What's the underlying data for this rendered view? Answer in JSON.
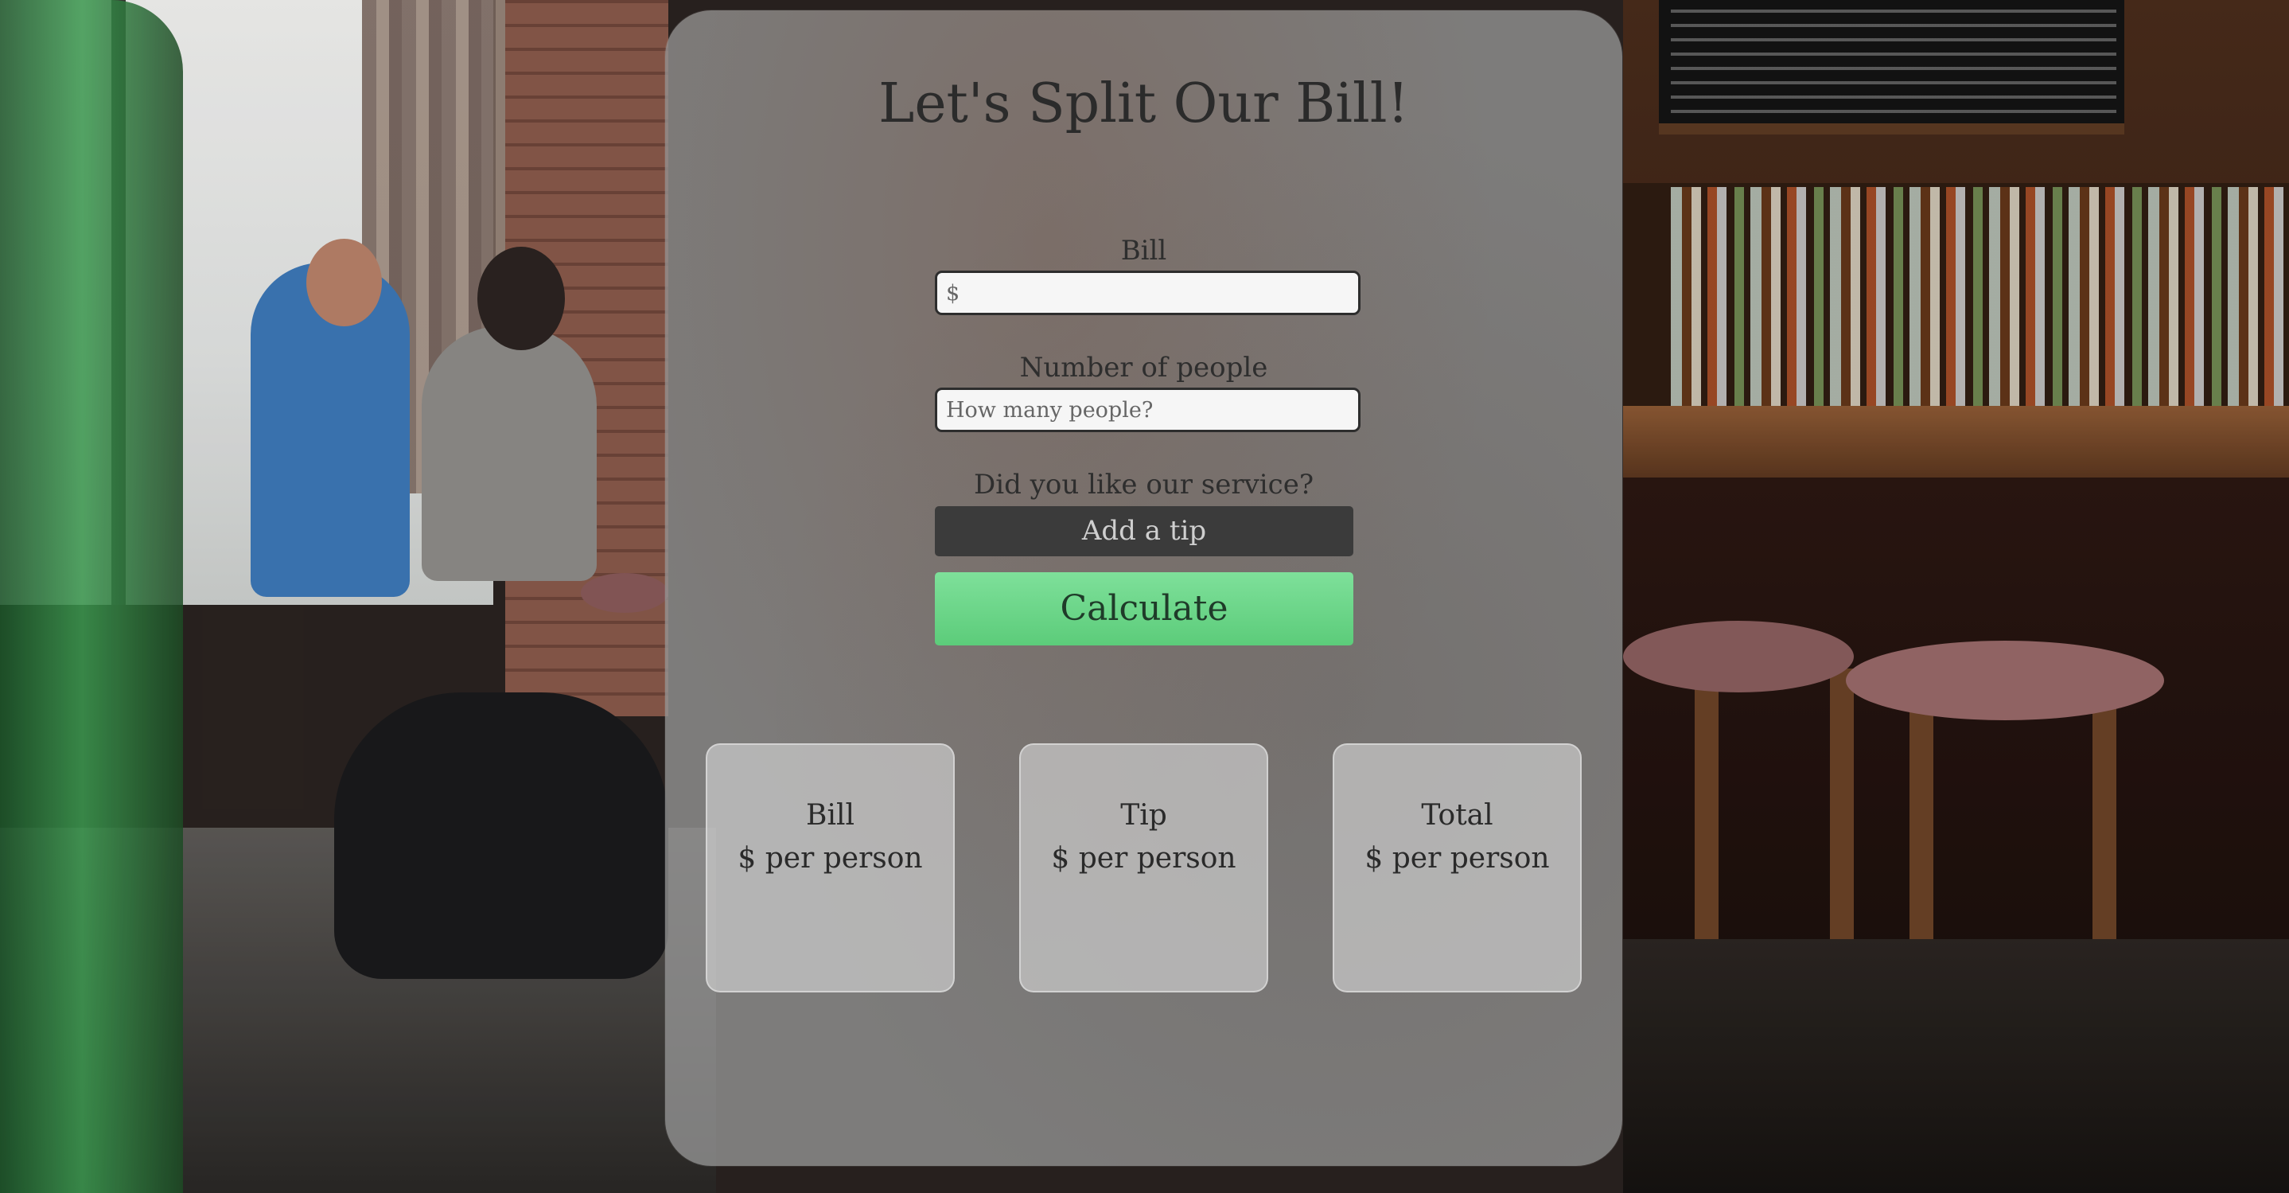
{
  "app": {
    "title": "Let's Split Our Bill!"
  },
  "form": {
    "bill_label": "Bill",
    "bill_placeholder": "$",
    "bill_value": "",
    "people_label": "Number of people",
    "people_placeholder": "How many people?",
    "people_value": "",
    "service_question": "Did you like our service?",
    "tip_button_label": "Add a tip",
    "calculate_button_label": "Calculate"
  },
  "results": [
    {
      "title": "Bill",
      "value": "$ per person"
    },
    {
      "title": "Tip",
      "value": "$ per person"
    },
    {
      "title": "Total",
      "value": "$ per person"
    }
  ],
  "colors": {
    "calculate_accent": "#6fd78a",
    "tip_button_bg": "#3b3b3b"
  }
}
